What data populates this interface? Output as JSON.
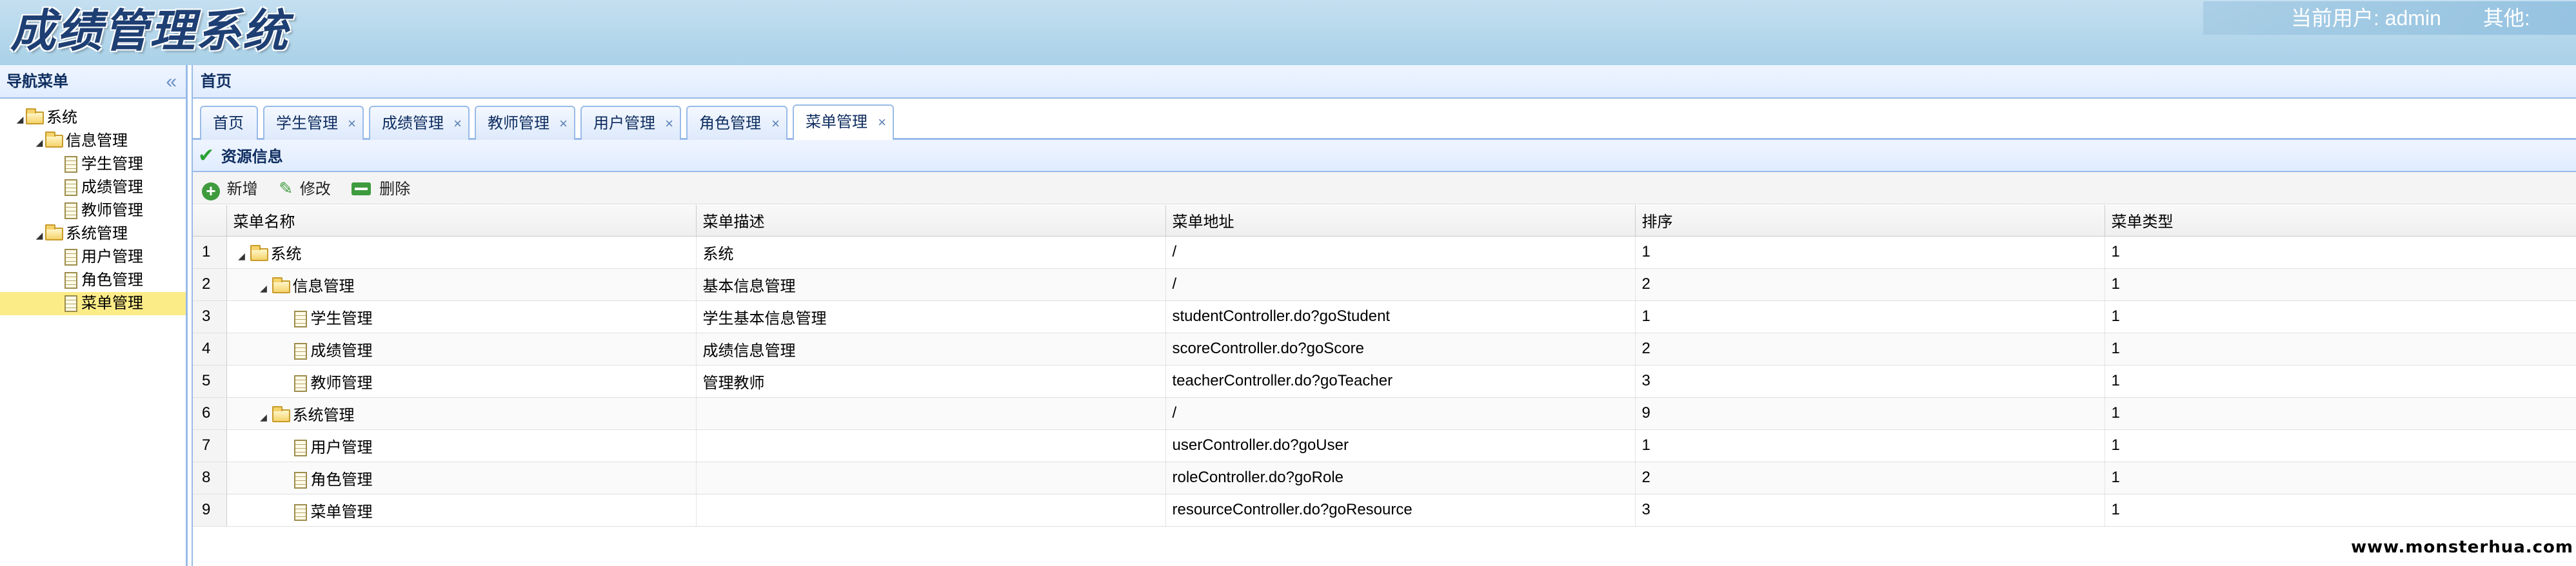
{
  "header": {
    "logo": "成绩管理系统",
    "current_user_label": "当前用户: admin",
    "other_label": "其他:"
  },
  "nav": {
    "title": "导航菜单",
    "collapse_icon": "«",
    "tree": [
      {
        "label": "系统",
        "type": "folder",
        "level": 0,
        "expanded": true
      },
      {
        "label": "信息管理",
        "type": "folder",
        "level": 1,
        "expanded": true
      },
      {
        "label": "学生管理",
        "type": "file",
        "level": 2
      },
      {
        "label": "成绩管理",
        "type": "file",
        "level": 2
      },
      {
        "label": "教师管理",
        "type": "file",
        "level": 2
      },
      {
        "label": "系统管理",
        "type": "folder",
        "level": 1,
        "expanded": true
      },
      {
        "label": "用户管理",
        "type": "file",
        "level": 2
      },
      {
        "label": "角色管理",
        "type": "file",
        "level": 2
      },
      {
        "label": "菜单管理",
        "type": "file",
        "level": 2,
        "selected": true
      }
    ]
  },
  "main": {
    "title": "首页",
    "tabs": [
      {
        "label": "首页",
        "closable": false
      },
      {
        "label": "学生管理",
        "closable": true
      },
      {
        "label": "成绩管理",
        "closable": true
      },
      {
        "label": "教师管理",
        "closable": true
      },
      {
        "label": "用户管理",
        "closable": true
      },
      {
        "label": "角色管理",
        "closable": true
      },
      {
        "label": "菜单管理",
        "closable": true,
        "active": true
      }
    ],
    "close_glyph": "×"
  },
  "panel": {
    "title": "资源信息",
    "toolbar": {
      "add_label": "新增",
      "edit_label": "修改",
      "delete_label": "删除"
    }
  },
  "grid": {
    "columns": [
      "菜单名称",
      "菜单描述",
      "菜单地址",
      "排序",
      "菜单类型"
    ],
    "rows": [
      {
        "num": "1",
        "name": "系统",
        "kind": "folder",
        "level": 0,
        "desc": "系统",
        "url": "/",
        "order": "1",
        "type": "1"
      },
      {
        "num": "2",
        "name": "信息管理",
        "kind": "folder",
        "level": 1,
        "desc": "基本信息管理",
        "url": "/",
        "order": "2",
        "type": "1"
      },
      {
        "num": "3",
        "name": "学生管理",
        "kind": "file",
        "level": 2,
        "desc": "学生基本信息管理",
        "url": "studentController.do?goStudent",
        "order": "1",
        "type": "1"
      },
      {
        "num": "4",
        "name": "成绩管理",
        "kind": "file",
        "level": 2,
        "desc": "成绩信息管理",
        "url": "scoreController.do?goScore",
        "order": "2",
        "type": "1"
      },
      {
        "num": "5",
        "name": "教师管理",
        "kind": "file",
        "level": 2,
        "desc": "管理教师",
        "url": "teacherController.do?goTeacher",
        "order": "3",
        "type": "1"
      },
      {
        "num": "6",
        "name": "系统管理",
        "kind": "folder",
        "level": 1,
        "desc": "",
        "url": "/",
        "order": "9",
        "type": "1"
      },
      {
        "num": "7",
        "name": "用户管理",
        "kind": "file",
        "level": 2,
        "desc": "",
        "url": "userController.do?goUser",
        "order": "1",
        "type": "1"
      },
      {
        "num": "8",
        "name": "角色管理",
        "kind": "file",
        "level": 2,
        "desc": "",
        "url": "roleController.do?goRole",
        "order": "2",
        "type": "1"
      },
      {
        "num": "9",
        "name": "菜单管理",
        "kind": "file",
        "level": 2,
        "desc": "",
        "url": "resourceController.do?goResource",
        "order": "3",
        "type": "1"
      }
    ]
  },
  "watermark": "www.monsterhua.com"
}
